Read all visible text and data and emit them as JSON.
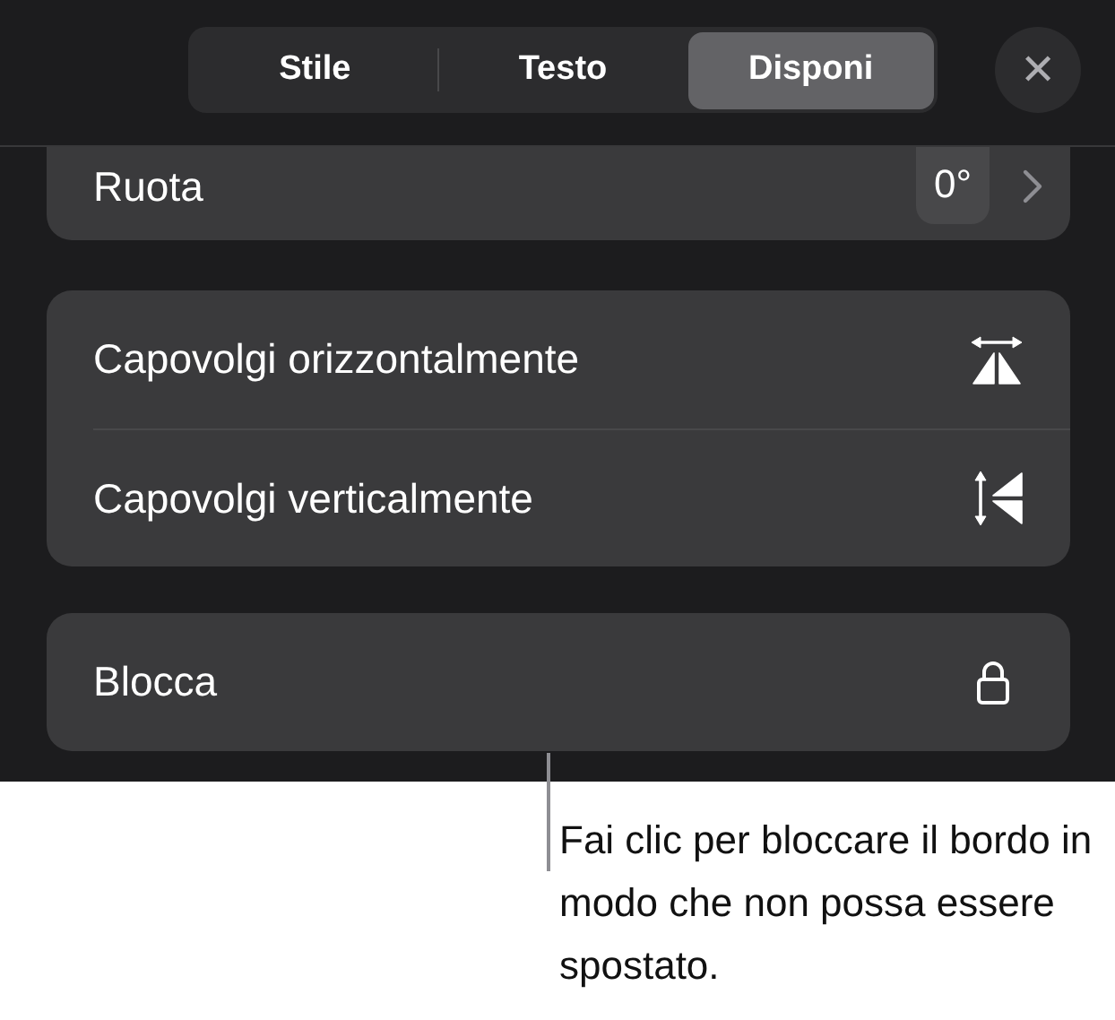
{
  "tabs": [
    {
      "label": "Stile",
      "selected": false
    },
    {
      "label": "Testo",
      "selected": false
    },
    {
      "label": "Disponi",
      "selected": true
    }
  ],
  "close_button": {
    "label": "✕"
  },
  "rotate": {
    "label": "Ruota",
    "value": "0°"
  },
  "flip_rows": [
    {
      "label": "Capovolgi orizzontalmente",
      "kind": "horizontal"
    },
    {
      "label": "Capovolgi verticalmente",
      "kind": "vertical"
    }
  ],
  "lock_row": {
    "label": "Blocca"
  },
  "callout": "Fai clic per bloccare il bordo in modo che non possa essere spostato."
}
